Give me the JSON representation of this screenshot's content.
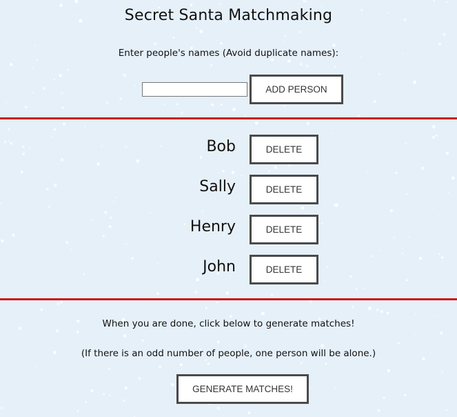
{
  "page": {
    "title": "Secret Santa Matchmaking",
    "instructions": "Enter people's names (Avoid duplicate names):"
  },
  "add_form": {
    "input_value": "",
    "add_button_label": "ADD PERSON"
  },
  "people": [
    {
      "name": "Bob",
      "delete_label": "DELETE"
    },
    {
      "name": "Sally",
      "delete_label": "DELETE"
    },
    {
      "name": "Henry",
      "delete_label": "DELETE"
    },
    {
      "name": "John",
      "delete_label": "DELETE"
    }
  ],
  "footer": {
    "done_text": "When you are done, click below to generate matches!",
    "odd_note": "(If there is an odd number of people, one person will be alone.)",
    "generate_label": "GENERATE MATCHES!"
  },
  "colors": {
    "background": "#e6f0f9",
    "divider": "#cc1111",
    "button_border": "#4a4a4a"
  }
}
